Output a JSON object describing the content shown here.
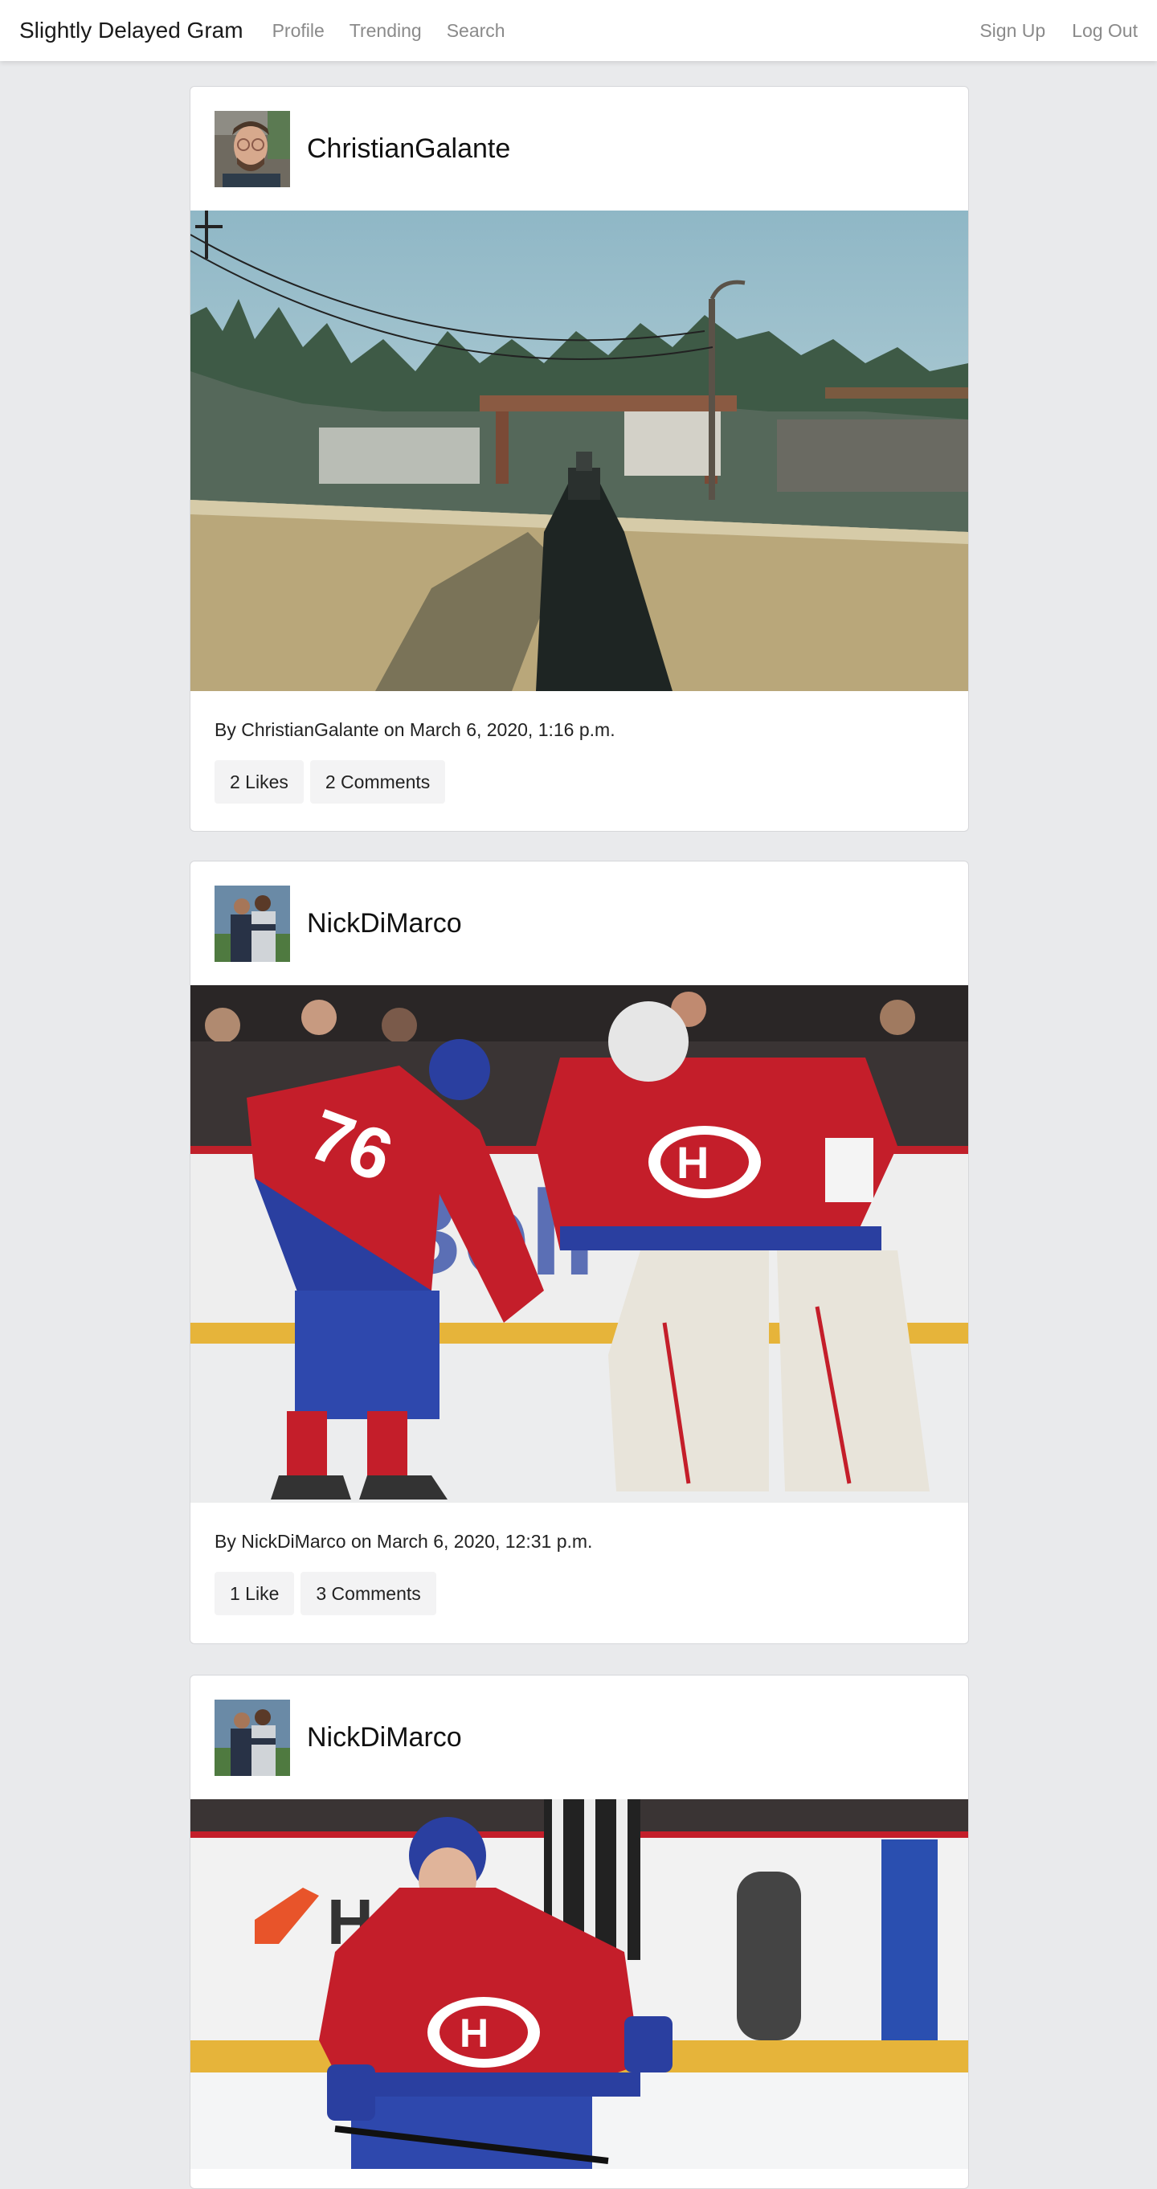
{
  "nav": {
    "brand": "Slightly Delayed Gram",
    "links": [
      "Profile",
      "Trending",
      "Search"
    ],
    "right_links": [
      "Sign Up",
      "Log Out"
    ]
  },
  "posts": [
    {
      "username": "ChristianGalante",
      "image": "first-person game screenshot of rifle aimed over wall at industrial area",
      "byline": "By ChristianGalante on March 6, 2020, 1:16 p.m.",
      "likes": "2 Likes",
      "comments": "2 Comments"
    },
    {
      "username": "NickDiMarco",
      "image": "hockey players in red jerseys, number 76 and goalie number 31",
      "byline": "By NickDiMarco on March 6, 2020, 12:31 p.m.",
      "likes": "1 Like",
      "comments": "3 Comments"
    },
    {
      "username": "NickDiMarco",
      "image": "hockey player in red jersey skating with stick"
    }
  ],
  "colors": {
    "page_background": "#e9eaec",
    "card_background": "#ffffff",
    "nav_link": "#8a8a8a",
    "pill_background": "#f3f3f4"
  }
}
